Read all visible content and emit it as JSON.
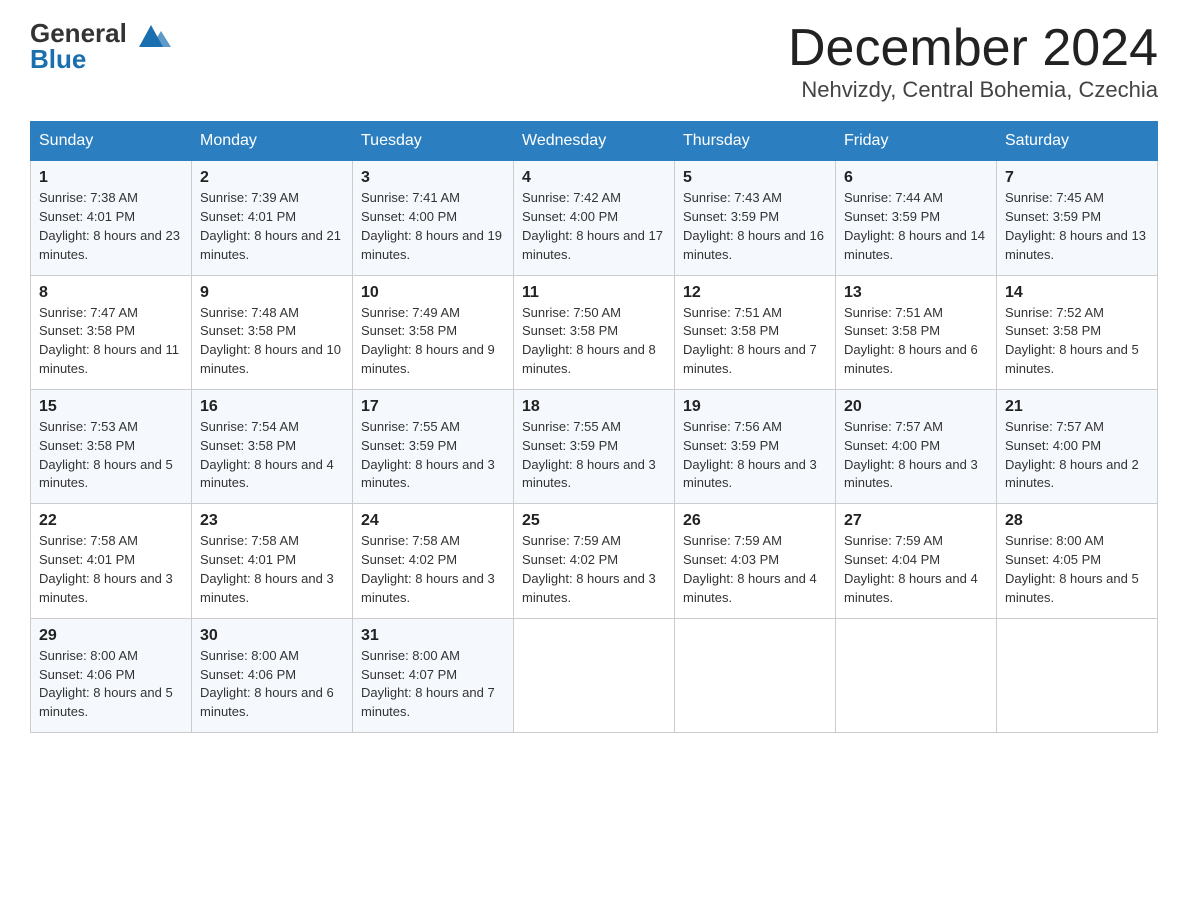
{
  "header": {
    "logo_general": "General",
    "logo_blue": "Blue",
    "month_title": "December 2024",
    "location": "Nehvizdy, Central Bohemia, Czechia"
  },
  "days_of_week": [
    "Sunday",
    "Monday",
    "Tuesday",
    "Wednesday",
    "Thursday",
    "Friday",
    "Saturday"
  ],
  "weeks": [
    [
      {
        "day": "1",
        "sunrise": "7:38 AM",
        "sunset": "4:01 PM",
        "daylight": "8 hours and 23 minutes."
      },
      {
        "day": "2",
        "sunrise": "7:39 AM",
        "sunset": "4:01 PM",
        "daylight": "8 hours and 21 minutes."
      },
      {
        "day": "3",
        "sunrise": "7:41 AM",
        "sunset": "4:00 PM",
        "daylight": "8 hours and 19 minutes."
      },
      {
        "day": "4",
        "sunrise": "7:42 AM",
        "sunset": "4:00 PM",
        "daylight": "8 hours and 17 minutes."
      },
      {
        "day": "5",
        "sunrise": "7:43 AM",
        "sunset": "3:59 PM",
        "daylight": "8 hours and 16 minutes."
      },
      {
        "day": "6",
        "sunrise": "7:44 AM",
        "sunset": "3:59 PM",
        "daylight": "8 hours and 14 minutes."
      },
      {
        "day": "7",
        "sunrise": "7:45 AM",
        "sunset": "3:59 PM",
        "daylight": "8 hours and 13 minutes."
      }
    ],
    [
      {
        "day": "8",
        "sunrise": "7:47 AM",
        "sunset": "3:58 PM",
        "daylight": "8 hours and 11 minutes."
      },
      {
        "day": "9",
        "sunrise": "7:48 AM",
        "sunset": "3:58 PM",
        "daylight": "8 hours and 10 minutes."
      },
      {
        "day": "10",
        "sunrise": "7:49 AM",
        "sunset": "3:58 PM",
        "daylight": "8 hours and 9 minutes."
      },
      {
        "day": "11",
        "sunrise": "7:50 AM",
        "sunset": "3:58 PM",
        "daylight": "8 hours and 8 minutes."
      },
      {
        "day": "12",
        "sunrise": "7:51 AM",
        "sunset": "3:58 PM",
        "daylight": "8 hours and 7 minutes."
      },
      {
        "day": "13",
        "sunrise": "7:51 AM",
        "sunset": "3:58 PM",
        "daylight": "8 hours and 6 minutes."
      },
      {
        "day": "14",
        "sunrise": "7:52 AM",
        "sunset": "3:58 PM",
        "daylight": "8 hours and 5 minutes."
      }
    ],
    [
      {
        "day": "15",
        "sunrise": "7:53 AM",
        "sunset": "3:58 PM",
        "daylight": "8 hours and 5 minutes."
      },
      {
        "day": "16",
        "sunrise": "7:54 AM",
        "sunset": "3:58 PM",
        "daylight": "8 hours and 4 minutes."
      },
      {
        "day": "17",
        "sunrise": "7:55 AM",
        "sunset": "3:59 PM",
        "daylight": "8 hours and 3 minutes."
      },
      {
        "day": "18",
        "sunrise": "7:55 AM",
        "sunset": "3:59 PM",
        "daylight": "8 hours and 3 minutes."
      },
      {
        "day": "19",
        "sunrise": "7:56 AM",
        "sunset": "3:59 PM",
        "daylight": "8 hours and 3 minutes."
      },
      {
        "day": "20",
        "sunrise": "7:57 AM",
        "sunset": "4:00 PM",
        "daylight": "8 hours and 3 minutes."
      },
      {
        "day": "21",
        "sunrise": "7:57 AM",
        "sunset": "4:00 PM",
        "daylight": "8 hours and 2 minutes."
      }
    ],
    [
      {
        "day": "22",
        "sunrise": "7:58 AM",
        "sunset": "4:01 PM",
        "daylight": "8 hours and 3 minutes."
      },
      {
        "day": "23",
        "sunrise": "7:58 AM",
        "sunset": "4:01 PM",
        "daylight": "8 hours and 3 minutes."
      },
      {
        "day": "24",
        "sunrise": "7:58 AM",
        "sunset": "4:02 PM",
        "daylight": "8 hours and 3 minutes."
      },
      {
        "day": "25",
        "sunrise": "7:59 AM",
        "sunset": "4:02 PM",
        "daylight": "8 hours and 3 minutes."
      },
      {
        "day": "26",
        "sunrise": "7:59 AM",
        "sunset": "4:03 PM",
        "daylight": "8 hours and 4 minutes."
      },
      {
        "day": "27",
        "sunrise": "7:59 AM",
        "sunset": "4:04 PM",
        "daylight": "8 hours and 4 minutes."
      },
      {
        "day": "28",
        "sunrise": "8:00 AM",
        "sunset": "4:05 PM",
        "daylight": "8 hours and 5 minutes."
      }
    ],
    [
      {
        "day": "29",
        "sunrise": "8:00 AM",
        "sunset": "4:06 PM",
        "daylight": "8 hours and 5 minutes."
      },
      {
        "day": "30",
        "sunrise": "8:00 AM",
        "sunset": "4:06 PM",
        "daylight": "8 hours and 6 minutes."
      },
      {
        "day": "31",
        "sunrise": "8:00 AM",
        "sunset": "4:07 PM",
        "daylight": "8 hours and 7 minutes."
      },
      null,
      null,
      null,
      null
    ]
  ]
}
